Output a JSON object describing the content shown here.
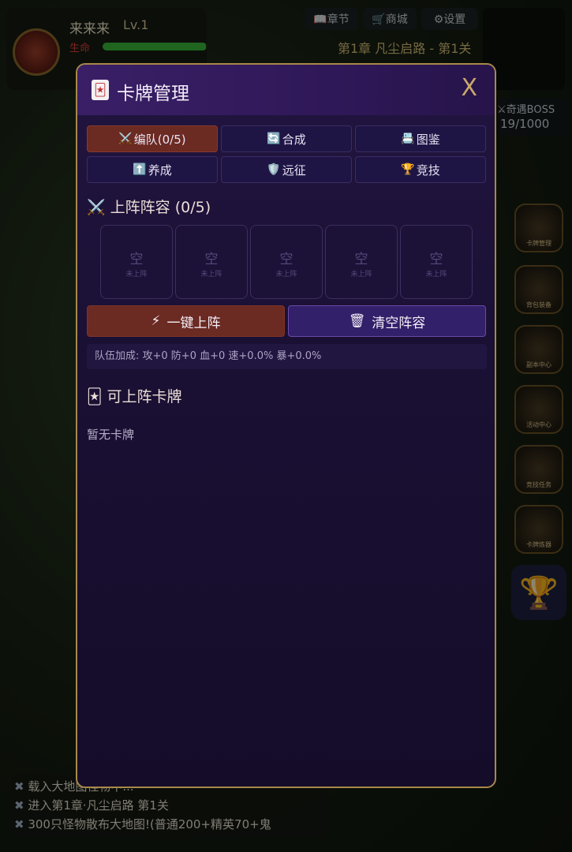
{
  "player": {
    "name": "来来来",
    "level": "Lv.1",
    "hp_label": "生命",
    "hp_fraction": 0.99
  },
  "top_nav": {
    "chapter_btn": "📖章节",
    "shop_btn": "🛒商城",
    "settings_btn": "⚙设置"
  },
  "chapter_title": "第1章 凡尘启路 - 第1关",
  "boss": {
    "title": "⚔奇遇BOSS",
    "count": "19/1000"
  },
  "side_icons": [
    "卡牌管理",
    "背包装备",
    "副本中心",
    "活动中心",
    "竞技任务",
    "卡牌炼器"
  ],
  "log": {
    "lines": [
      "载入大地图怪物中...",
      "进入第1章·凡尘启路 第1关",
      "300只怪物散布大地图!(普通200+精英70+鬼"
    ]
  },
  "modal": {
    "title": "卡牌管理",
    "close_label": "X",
    "tabs": [
      {
        "icon": "⚔️",
        "label": "编队(0/5)",
        "active": true
      },
      {
        "icon": "🔄",
        "label": "合成",
        "active": false
      },
      {
        "icon": "📇",
        "label": "图鉴",
        "active": false
      },
      {
        "icon": "⬆️",
        "label": "养成",
        "active": false
      },
      {
        "icon": "🛡️",
        "label": "远征",
        "active": false
      },
      {
        "icon": "🏆",
        "label": "竞技",
        "active": false
      }
    ],
    "lineup_title": "上阵阵容 (0/5)",
    "slots": [
      {
        "main": "空",
        "sub": "未上阵"
      },
      {
        "main": "空",
        "sub": "未上阵"
      },
      {
        "main": "空",
        "sub": "未上阵"
      },
      {
        "main": "空",
        "sub": "未上阵"
      },
      {
        "main": "空",
        "sub": "未上阵"
      }
    ],
    "auto_deploy_btn": "一键上阵",
    "clear_lineup_btn": "清空阵容",
    "team_bonus": "队伍加成: 攻+0 防+0 血+0 速+0.0% 暴+0.0%",
    "available_title": "可上阵卡牌",
    "empty_text": "暂无卡牌"
  },
  "colors": {
    "modal_border": "#a8894a",
    "active_tab": "#6b2a22",
    "clear_button": "#33206a",
    "accent_gold": "#c9a86a"
  }
}
